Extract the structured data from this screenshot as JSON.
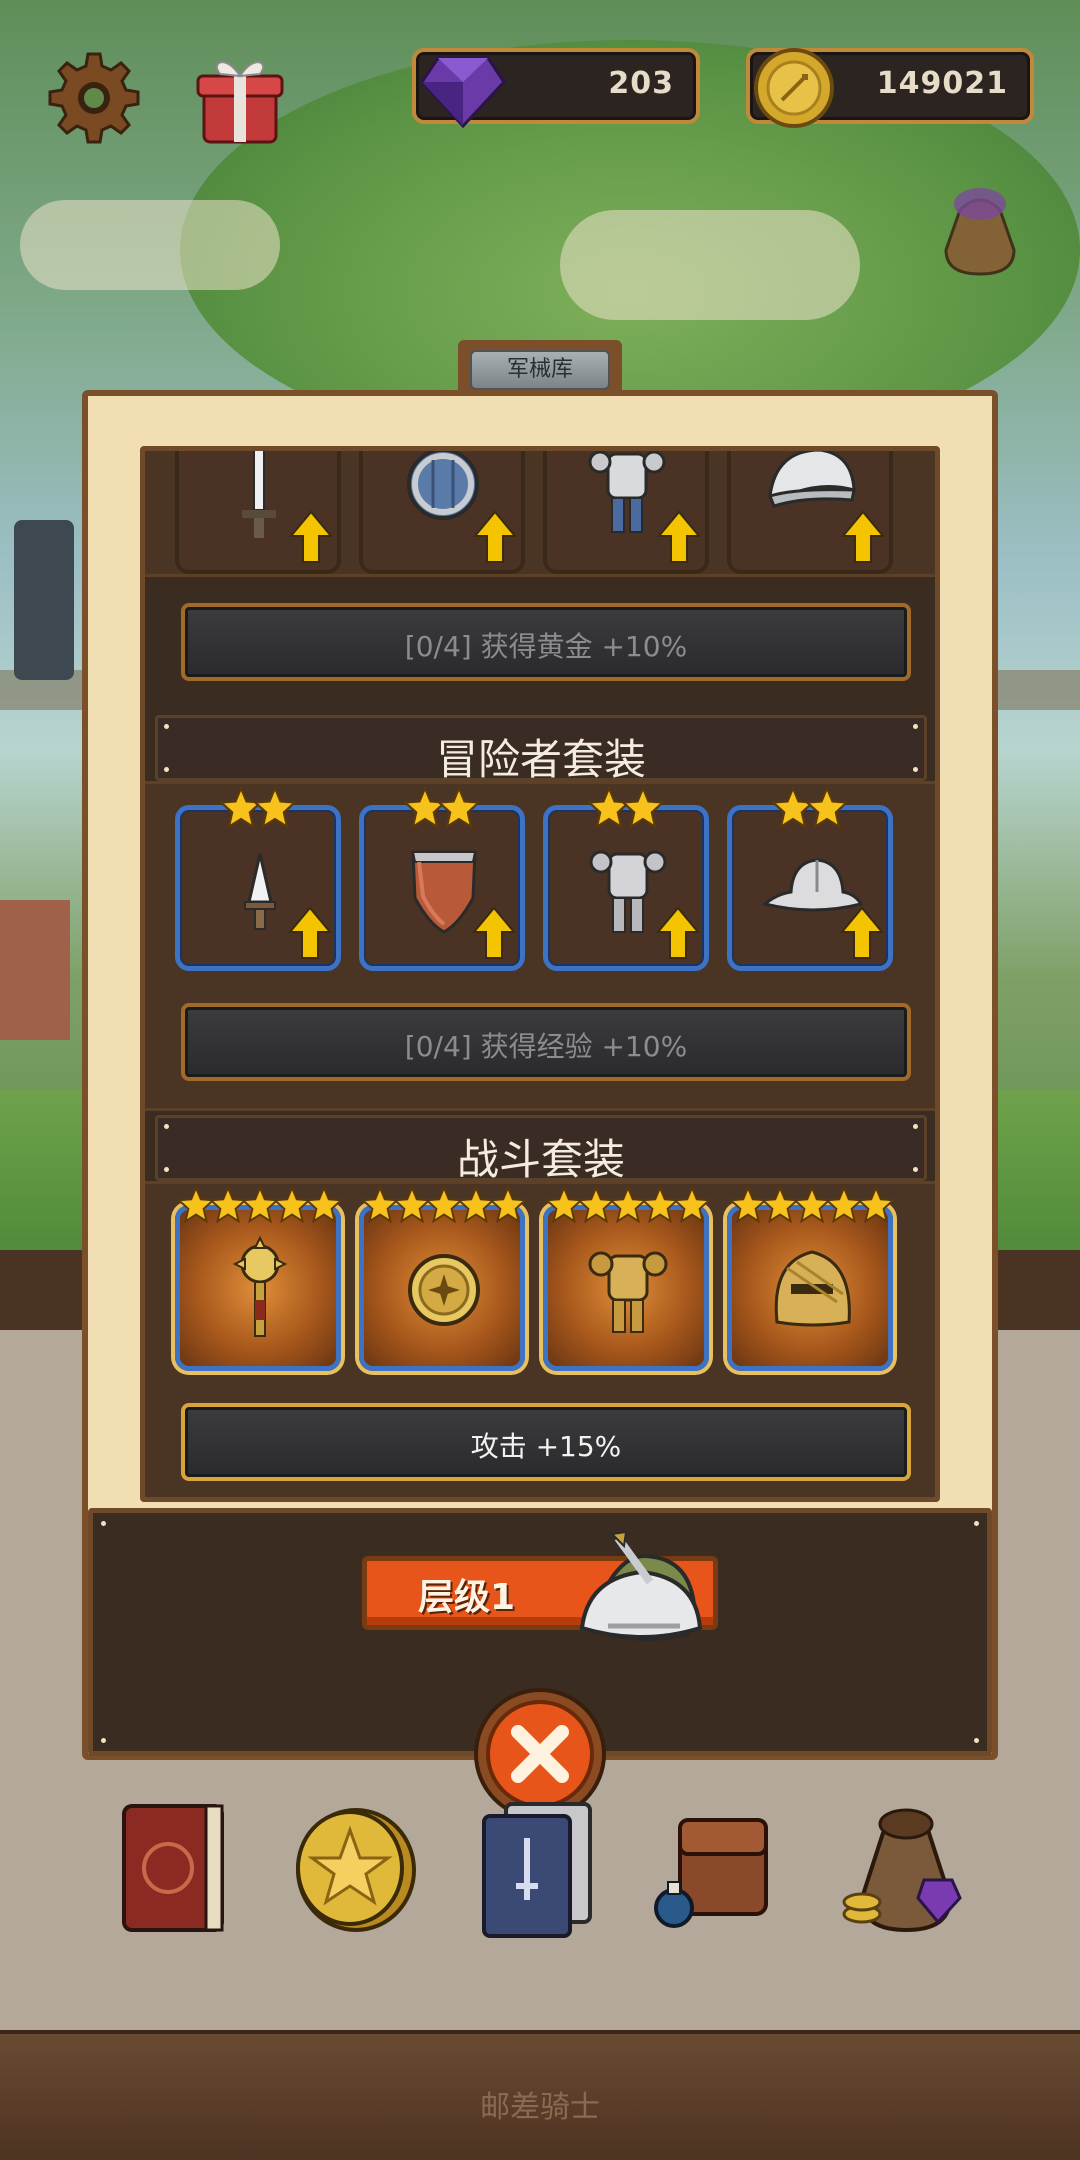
{
  "hud": {
    "gems": "203",
    "coins": "149021",
    "settings_icon": "gear-icon",
    "gift_icon": "gift-icon",
    "gem_icon": "purple-gem-icon",
    "coin_icon": "gold-coin-icon"
  },
  "panel": {
    "title": "军械库",
    "sets": [
      {
        "name": "",
        "items": [
          "sword-icon",
          "round-shield-icon",
          "plate-armor-icon",
          "steel-helmet-icon"
        ],
        "stars": 0,
        "bonus": "[0/4] 获得黄金 +10%",
        "active": false
      },
      {
        "name": "冒险者套装",
        "items": [
          "dagger-icon",
          "wooden-shield-icon",
          "armor-icon",
          "helmet-icon"
        ],
        "stars": 2,
        "bonus": "[0/4] 获得经验 +10%",
        "active": false
      },
      {
        "name": "战斗套装",
        "items": [
          "golden-mace-icon",
          "golden-shield-icon",
          "golden-armor-icon",
          "golden-helmet-icon"
        ],
        "stars": 5,
        "bonus": "攻击 +15%",
        "active": true
      }
    ]
  },
  "tier": {
    "label": "层级1"
  },
  "nav": {
    "items": [
      "spellbook-icon",
      "star-coin-icon",
      "card-deck-icon",
      "backpack-icon",
      "loot-bag-icon"
    ]
  },
  "footer": {
    "title": "邮差骑士"
  },
  "colors": {
    "panel_bg": "#f1dfb3",
    "panel_border": "#7a4f2a",
    "slot_blue": "#3d72c4",
    "tier_orange": "#e8551a",
    "star_yellow": "#f7c21c",
    "upgrade_arrow": "#f5c400"
  }
}
